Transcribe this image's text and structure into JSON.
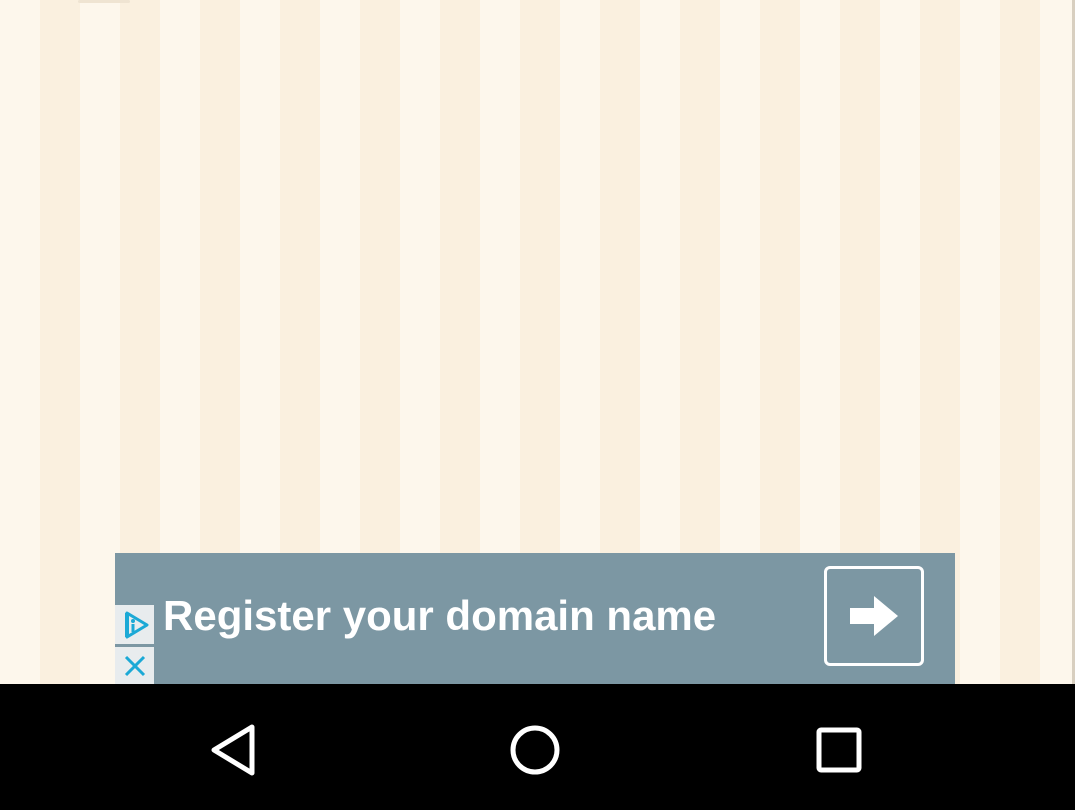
{
  "ad": {
    "text": "Register your domain name",
    "background_color": "#7c97a3",
    "arrow_icon": "arrow-right-icon",
    "choices_icon": "ad-choices-icon",
    "close_icon": "close-icon",
    "icon_color": "#1ba9d6"
  },
  "app": {
    "background_color": "#fcf3e4"
  },
  "navigation": {
    "icons": [
      "back-triangle-icon",
      "home-circle-icon",
      "recents-square-icon"
    ],
    "background_color": "#000000"
  }
}
